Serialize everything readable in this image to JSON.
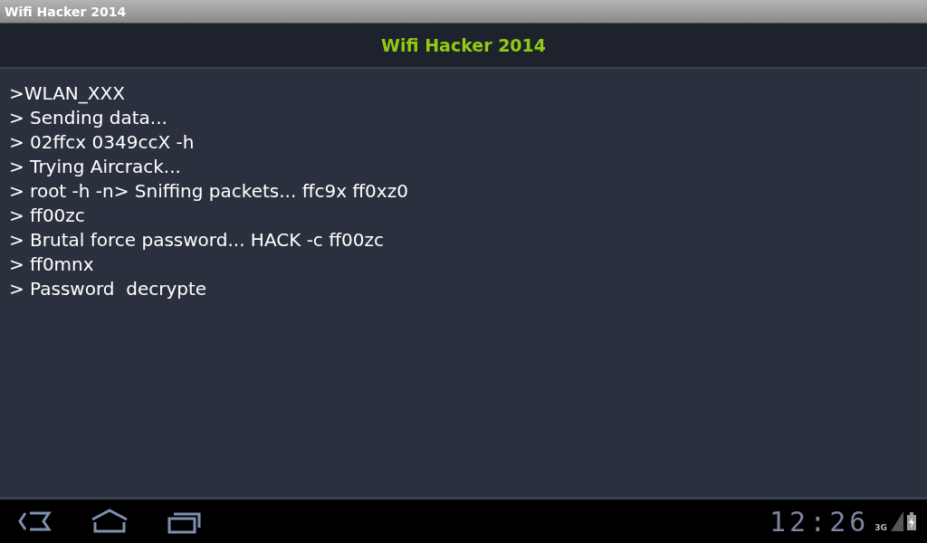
{
  "window": {
    "title": "Wifi Hacker 2014"
  },
  "action_bar": {
    "title": "Wifi Hacker 2014"
  },
  "console_lines": [
    ">WLAN_XXX",
    "> Sending data...",
    "> 02ffcx 0349ccX -h",
    "> Trying Aircrack...",
    "> root -h -n> Sniffing packets... ffc9x ff0xz0",
    "> ff00zc",
    "> Brutal force password... HACK -c ff00zc",
    "> ff0mnx",
    "> Password  decrypte"
  ],
  "system_bar": {
    "clock": "12:26",
    "network": "3G"
  }
}
